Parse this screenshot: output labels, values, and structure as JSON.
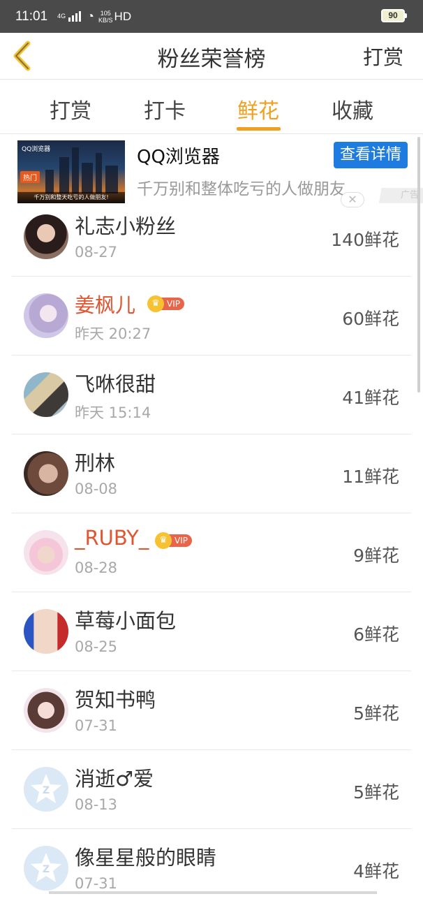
{
  "status_bar": {
    "time": "11:01",
    "network": "4G",
    "speed_value": "105",
    "speed_unit": "KB/S",
    "hd": "HD",
    "battery": "90"
  },
  "header": {
    "title": "粉丝荣誉榜",
    "right_action": "打赏"
  },
  "tabs": [
    {
      "label": "打赏",
      "active": false
    },
    {
      "label": "打卡",
      "active": false
    },
    {
      "label": "鲜花",
      "active": true
    },
    {
      "label": "收藏",
      "active": false
    }
  ],
  "ad": {
    "title": "QQ浏览器",
    "description": "千万别和整体吃亏的人做朋友",
    "button": "查看详情",
    "close": "✕",
    "label": "广告",
    "image_logo": "QQ浏览器",
    "image_badge": "热门",
    "image_caption": "千万别和整天吃亏的人做朋友!"
  },
  "fans": [
    {
      "name": "礼志小粉丝",
      "date": "08-27",
      "count": "140鲜花",
      "vip": false,
      "avatar": "photo"
    },
    {
      "name": "姜枫儿",
      "date": "昨天 20:27",
      "count": "60鲜花",
      "vip": true,
      "avatar": "photo"
    },
    {
      "name": "飞咻很甜",
      "date": "昨天 15:14",
      "count": "41鲜花",
      "vip": false,
      "avatar": "photo"
    },
    {
      "name": "刑林",
      "date": "08-08",
      "count": "11鲜花",
      "vip": false,
      "avatar": "photo"
    },
    {
      "name": "_RUBY_",
      "date": "08-28",
      "count": "9鲜花",
      "vip": true,
      "avatar": "photo"
    },
    {
      "name": "草莓小面包",
      "date": "08-25",
      "count": "6鲜花",
      "vip": false,
      "avatar": "photo"
    },
    {
      "name": "贺知书鸭",
      "date": "07-31",
      "count": "5鲜花",
      "vip": false,
      "avatar": "photo"
    },
    {
      "name": "消逝♂爱",
      "date": "08-13",
      "count": "5鲜花",
      "vip": false,
      "avatar": "default"
    },
    {
      "name": "像星星般的眼睛",
      "date": "07-31",
      "count": "4鲜花",
      "vip": false,
      "avatar": "default"
    }
  ],
  "vip_label": "VIP",
  "colors": {
    "accent": "#f0a020",
    "vip_name": "#e05532",
    "ad_button": "#1e7be0",
    "status_bar": "#4a4a4a"
  }
}
